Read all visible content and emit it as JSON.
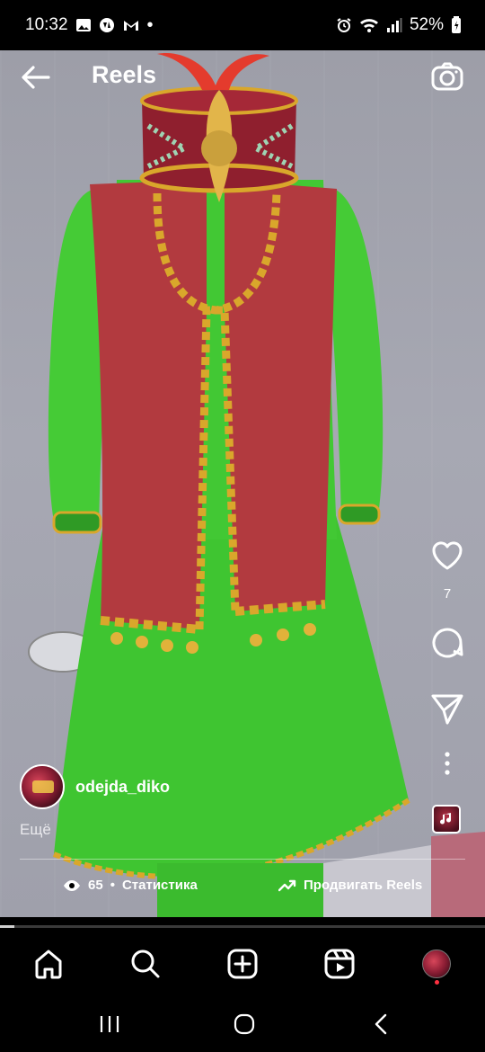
{
  "status_bar": {
    "time": "10:32",
    "left_icons": [
      "gallery-icon",
      "vpn-globe-icon",
      "gmail-icon"
    ],
    "dot": "•",
    "battery_percent": "52%",
    "right_icons": [
      "alarm-icon",
      "wifi-icon",
      "signal-icon",
      "battery-icon"
    ]
  },
  "header": {
    "title": "Reels"
  },
  "actions": {
    "like_count": "7"
  },
  "author": {
    "username": "odejda_diko"
  },
  "caption": {
    "more_label": "Ещё"
  },
  "stats": {
    "views": "65",
    "separator": "•",
    "stats_label": "Статистика",
    "promote_label": "Продвигать Reels"
  },
  "progress": {
    "fraction": 0.03
  },
  "colors": {
    "accent_red": "#ff3040",
    "costume_green": "#3fc531",
    "costume_red": "#b23a3f",
    "gold": "#d9a72b"
  }
}
